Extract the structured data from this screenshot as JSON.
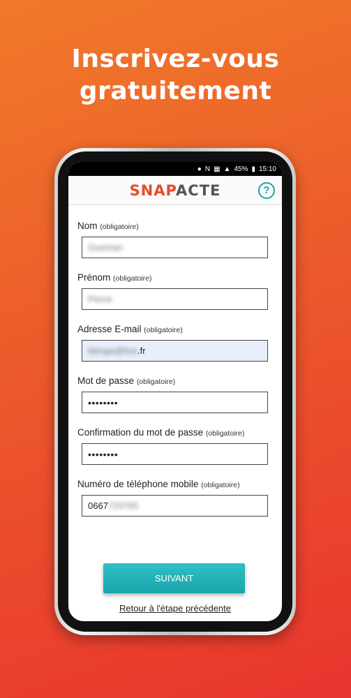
{
  "headline": {
    "line1": "Inscrivez-vous",
    "line2": "gratuitement"
  },
  "status_bar": {
    "battery": "45%",
    "time": "15:10",
    "icons": [
      "location-icon",
      "nfc-icon",
      "vibrate-icon",
      "signal-icon",
      "battery-icon"
    ]
  },
  "app": {
    "logo_part1": "SNAP",
    "logo_part2": "ACTE",
    "help_label": "?"
  },
  "form": {
    "fields": [
      {
        "label": "Nom",
        "hint": "(obligatoire)",
        "value": "Goeman"
      },
      {
        "label": "Prénom",
        "hint": "(obligatoire)",
        "value": "Pierre"
      },
      {
        "label": "Adresse E-mail",
        "hint": "(obligatoire)",
        "value_blurred": "blimge@live",
        "value_visible": ".fr"
      },
      {
        "label": "Mot de passe",
        "hint": "(obligatoire)",
        "value": "••••••••"
      },
      {
        "label": "Confirmation du mot de passe",
        "hint": "(obligatoire)",
        "value": "••••••••"
      },
      {
        "label": "Numéro de téléphone mobile",
        "hint": "(obligatoire)",
        "value_visible": "0667",
        "value_blurred": "724765"
      }
    ]
  },
  "actions": {
    "next_label": "SUIVANT",
    "back_label": "Retour à l'étape précédente"
  },
  "colors": {
    "accent": "#1fa3a8",
    "brand": "#e84b2a",
    "background_top": "#f07a2a",
    "background_bottom": "#e8342e"
  }
}
